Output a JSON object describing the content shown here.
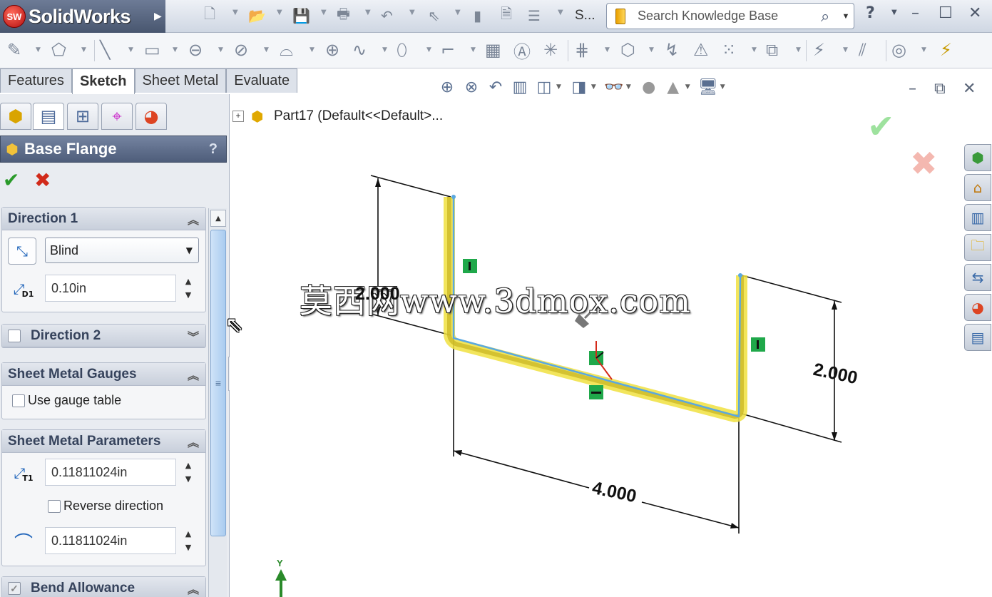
{
  "app": {
    "name": "SolidWorks",
    "logo_text": "SW",
    "doc_abbrev": "S...",
    "search": {
      "placeholder": "Search Knowledge Base"
    },
    "help_icon": "?"
  },
  "command_tabs": [
    {
      "label": "Features",
      "active": false
    },
    {
      "label": "Sketch",
      "active": true
    },
    {
      "label": "Sheet Metal",
      "active": false
    },
    {
      "label": "Evaluate",
      "active": false
    }
  ],
  "property_manager": {
    "title": "Base Flange",
    "help": "?",
    "direction1": {
      "title": "Direction 1",
      "end_condition": "Blind",
      "depth": "0.10in",
      "depth_icon_sub": "D1"
    },
    "direction2": {
      "title": "Direction 2"
    },
    "gauges": {
      "title": "Sheet Metal Gauges",
      "use_gauge_table": "Use gauge table"
    },
    "parameters": {
      "title": "Sheet Metal Parameters",
      "thickness": "0.11811024in",
      "thickness_icon_sub": "T1",
      "reverse_direction": "Reverse direction",
      "bend_radius": "0.11811024in"
    },
    "bend_allowance": {
      "title": "Bend Allowance"
    }
  },
  "feature_tree": {
    "expand": "+",
    "root_label": "Part17  (Default<<Default>..."
  },
  "sketch": {
    "dim_left": "2.000",
    "dim_right": "2.000",
    "dim_bottom": "4.000",
    "axis_label": "Y"
  },
  "watermark": "莫西网www.3dmox.com",
  "colors": {
    "highlight": "#f0e040",
    "sketch_line": "#5aa8e0",
    "relation_green": "#1fa84a",
    "accent": "#4e5d7a"
  },
  "icons": {
    "ok": "green-check-icon",
    "cancel": "red-x-icon",
    "search": "magnifier-icon"
  }
}
